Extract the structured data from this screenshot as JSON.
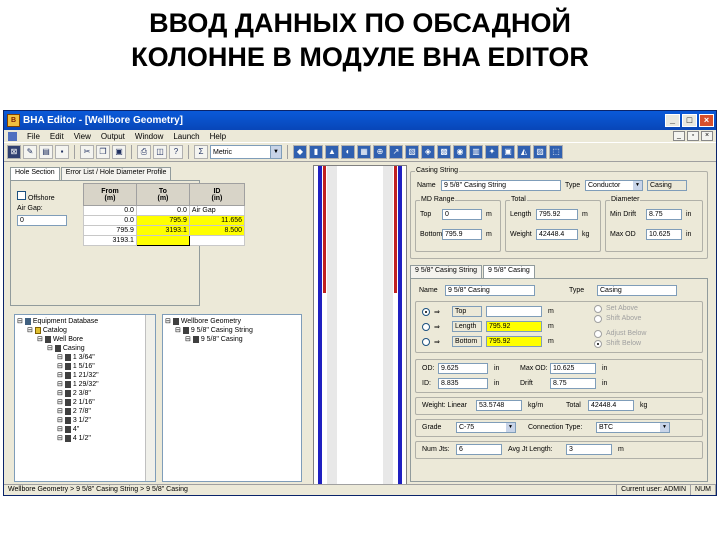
{
  "slide": {
    "title_line1": "ВВОД ДАННЫХ ПО ОБСАДНОЙ",
    "title_line2": "КОЛОННЕ В МОДУЛЕ BHA EDITOR"
  },
  "window": {
    "title": "BHA Editor - [Wellbore Geometry]",
    "controls": {
      "minimize": "_",
      "maximize": "□",
      "close": "×"
    }
  },
  "menu": [
    "File",
    "Edit",
    "View",
    "Output",
    "Window",
    "Launch",
    "Help"
  ],
  "toolbar": {
    "units_select": "Metric"
  },
  "left_panel": {
    "tabs": [
      "Hole Section",
      "Error List / Hole Diameter Profile"
    ],
    "offshore_label": "Offshore",
    "air_gap_label": "Air Gap:",
    "air_gap_value": "0",
    "grid_headers": [
      {
        "line1": "From",
        "line2": "(m)"
      },
      {
        "line1": "To",
        "line2": "(m)"
      },
      {
        "line1": "ID",
        "line2": "(in)"
      }
    ],
    "grid_rows": [
      [
        "0.0",
        "0.0",
        "Air Gap"
      ],
      [
        "0.0",
        "795.9",
        "11.656"
      ],
      [
        "795.9",
        "3193.1",
        "8.500"
      ],
      [
        "3193.1",
        "",
        ""
      ]
    ]
  },
  "tree_left": {
    "items": [
      {
        "label": "Equipment Database",
        "indent": 0,
        "icon": "db"
      },
      {
        "label": "Catalog",
        "indent": 1,
        "icon": "cat"
      },
      {
        "label": "Well Bore",
        "indent": 2,
        "icon": "item"
      },
      {
        "label": "Casing",
        "indent": 3,
        "icon": "item"
      },
      {
        "label": "1 3/64\"",
        "indent": 4,
        "icon": "item"
      },
      {
        "label": "1 5/16\"",
        "indent": 4,
        "icon": "item"
      },
      {
        "label": "1 21/32\"",
        "indent": 4,
        "icon": "item"
      },
      {
        "label": "1 29/32\"",
        "indent": 4,
        "icon": "item"
      },
      {
        "label": "2 3/8\"",
        "indent": 4,
        "icon": "item"
      },
      {
        "label": "2 1/16\"",
        "indent": 4,
        "icon": "item"
      },
      {
        "label": "2 7/8\"",
        "indent": 4,
        "icon": "item"
      },
      {
        "label": "3 1/2\"",
        "indent": 4,
        "icon": "item"
      },
      {
        "label": "4\"",
        "indent": 4,
        "icon": "item"
      },
      {
        "label": "4 1/2\"",
        "indent": 4,
        "icon": "item"
      }
    ]
  },
  "tree_right": {
    "items": [
      {
        "label": "Wellbore Geometry",
        "indent": 0
      },
      {
        "label": "9 5/8\" Casing String",
        "indent": 1
      },
      {
        "label": "9 5/8\" Casing",
        "indent": 2
      }
    ]
  },
  "casing_string": {
    "group_label": "Casing String",
    "name_label": "Name",
    "name_value": "9 5/8\" Casing String",
    "type_label": "Type",
    "type_value": "Conductor",
    "type_extra": "Casing",
    "md_range_label": "MD Range",
    "top_label": "Top",
    "top_value": "0",
    "bottom_label": "Bottom",
    "bottom_value": "795.9",
    "unit_m": "m",
    "total_label": "Total",
    "length_label": "Length",
    "length_value": "795.92",
    "weight_label": "Weight",
    "weight_value": "42448.4",
    "unit_kg": "kg",
    "diameter_label": "Diameter",
    "min_drift_label": "Min Drift",
    "min_drift_value": "8.75",
    "max_od_label": "Max OD",
    "max_od_value": "10.625",
    "unit_in": "in"
  },
  "detail_tabs": [
    "9 5/8\" Casing String",
    "9 5/8\" Casing"
  ],
  "casing": {
    "name_label": "Name",
    "name_value": "9 5/8\" Casing",
    "type_label": "Type",
    "type_value": "Casing",
    "top_label": "Top",
    "length_label": "Length",
    "length_value": "795.92",
    "bottom_label": "Bottom",
    "bottom_value": "795.92",
    "unit_m": "m",
    "radio_options": [
      "Set Above",
      "Shift Above",
      "Adjust Below",
      "Shift Below"
    ],
    "od_label": "OD:",
    "od_value": "9.625",
    "max_od_label": "Max OD:",
    "max_od_value": "10.625",
    "id_label": "ID:",
    "id_value": "8.835",
    "drift_label": "Drift",
    "drift_value": "8.75",
    "unit_in": "in",
    "weight_linear_label": "Weight: Linear",
    "weight_linear_value": "53.5748",
    "unit_kgm": "kg/m",
    "total_label": "Total",
    "total_value": "42448.4",
    "unit_kg": "kg",
    "grade_label": "Grade",
    "grade_value": "C-75",
    "connection_label": "Connection Type:",
    "connection_value": "BTC",
    "num_jts_label": "Num Jts:",
    "num_jts_value": "6",
    "avg_jt_label": "Avg Jt Length:",
    "avg_jt_value": "3",
    "unit_m2": "m"
  },
  "status": {
    "path": "Wellbore Geometry  >  9 5/8\" Casing String  >  9 5/8\" Casing",
    "user": "Current user: ADMIN",
    "mode": "NUM"
  }
}
